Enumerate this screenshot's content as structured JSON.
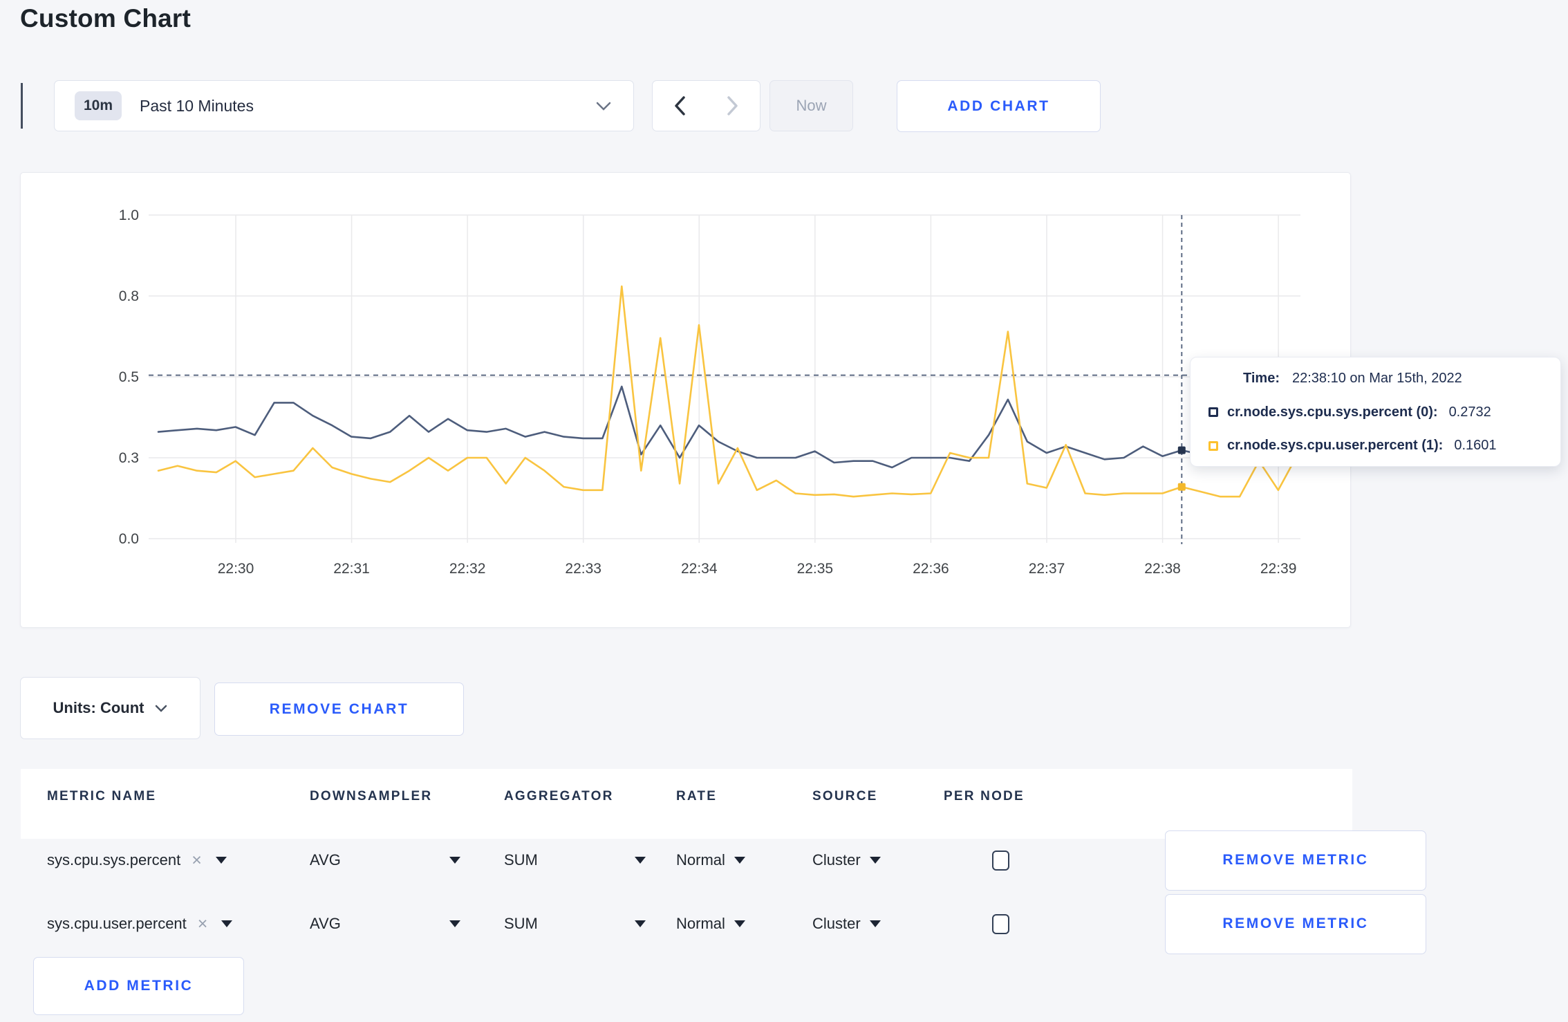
{
  "page": {
    "title": "Custom Chart"
  },
  "toolbar": {
    "range_badge": "10m",
    "range_label": "Past 10 Minutes",
    "now_label": "Now",
    "add_chart_label": "ADD CHART",
    "icons": [
      "chevron-down",
      "chevron-left",
      "chevron-right"
    ]
  },
  "chart_data": {
    "type": "line",
    "title": "",
    "xlabel": "",
    "ylabel": "",
    "ylim": [
      0,
      1
    ],
    "grid": true,
    "legend_position": "none",
    "start_time": "22:29:20",
    "interval_seconds": 10,
    "x_ticks": [
      "22:30",
      "22:31",
      "22:32",
      "22:33",
      "22:34",
      "22:35",
      "22:36",
      "22:37",
      "22:38",
      "22:39"
    ],
    "y_ticks": [
      {
        "value": 0,
        "label": "0.0"
      },
      {
        "value": 0.25,
        "label": "0.3"
      },
      {
        "value": 0.5,
        "label": "0.5"
      },
      {
        "value": 0.75,
        "label": "0.8"
      },
      {
        "value": 1.0,
        "label": "1.0"
      }
    ],
    "series": [
      {
        "name": "cr.node.sys.cpu.sys.percent",
        "color": "#4d5d7c",
        "dot_color": "#26354f",
        "values": [
          0.33,
          0.335,
          0.34,
          0.335,
          0.345,
          0.32,
          0.42,
          0.42,
          0.38,
          0.35,
          0.315,
          0.31,
          0.33,
          0.38,
          0.33,
          0.37,
          0.335,
          0.33,
          0.34,
          0.315,
          0.33,
          0.315,
          0.31,
          0.31,
          0.47,
          0.26,
          0.35,
          0.25,
          0.35,
          0.3,
          0.27,
          0.25,
          0.25,
          0.25,
          0.27,
          0.235,
          0.24,
          0.24,
          0.22,
          0.25,
          0.25,
          0.25,
          0.24,
          0.32,
          0.43,
          0.3,
          0.265,
          0.285,
          0.265,
          0.245,
          0.25,
          0.285,
          0.255,
          0.2732,
          0.26,
          0.27,
          0.29,
          0.3,
          0.3,
          0.305
        ]
      },
      {
        "name": "cr.node.sys.cpu.user.percent",
        "color": "#f9c440",
        "dot_color": "#f3b82b",
        "values": [
          0.21,
          0.225,
          0.21,
          0.205,
          0.24,
          0.19,
          0.2,
          0.21,
          0.28,
          0.22,
          0.2,
          0.185,
          0.175,
          0.21,
          0.25,
          0.21,
          0.25,
          0.25,
          0.17,
          0.25,
          0.21,
          0.16,
          0.15,
          0.15,
          0.78,
          0.21,
          0.62,
          0.17,
          0.66,
          0.17,
          0.28,
          0.15,
          0.18,
          0.14,
          0.135,
          0.137,
          0.13,
          0.135,
          0.14,
          0.137,
          0.14,
          0.265,
          0.25,
          0.25,
          0.64,
          0.17,
          0.157,
          0.29,
          0.14,
          0.135,
          0.14,
          0.14,
          0.14,
          0.1601,
          0.145,
          0.13,
          0.13,
          0.24,
          0.15,
          0.26
        ]
      }
    ],
    "crosshair": {
      "index": 53,
      "time": "22:38:10",
      "hline_value": 0.505,
      "dash_color": "#5d6b84"
    }
  },
  "tooltip": {
    "time_label": "Time:",
    "time_value": "22:38:10 on Mar 15th, 2022",
    "rows": [
      {
        "name": "cr.node.sys.cpu.sys.percent (0):",
        "value": "0.2732",
        "swatch": "#1e2d50"
      },
      {
        "name": "cr.node.sys.cpu.user.percent (1):",
        "value": "0.1601",
        "swatch": "#fdc12d"
      }
    ]
  },
  "chart_controls": {
    "units_label": "Units: Count",
    "remove_chart_label": "REMOVE CHART"
  },
  "metrics_table": {
    "headers": [
      "METRIC NAME",
      "DOWNSAMPLER",
      "AGGREGATOR",
      "RATE",
      "SOURCE",
      "PER NODE"
    ],
    "clear_icon_glyph": "×",
    "rows": [
      {
        "metric": "sys.cpu.sys.percent",
        "downsampler": "AVG",
        "aggregator": "SUM",
        "rate": "Normal",
        "source": "Cluster",
        "per_node_checked": false,
        "remove_label": "REMOVE METRIC"
      },
      {
        "metric": "sys.cpu.user.percent",
        "downsampler": "AVG",
        "aggregator": "SUM",
        "rate": "Normal",
        "source": "Cluster",
        "per_node_checked": false,
        "remove_label": "REMOVE METRIC"
      }
    ],
    "add_metric_label": "ADD METRIC"
  }
}
